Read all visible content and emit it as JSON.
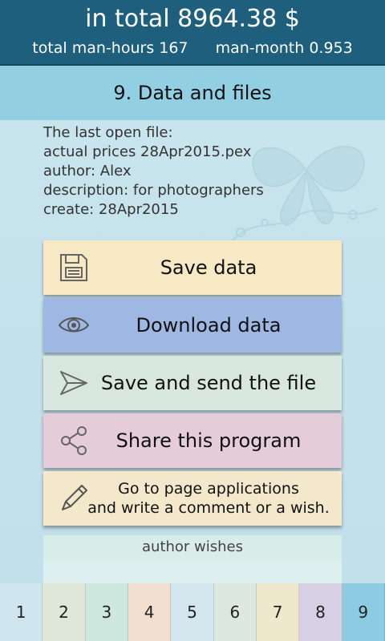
{
  "header": {
    "total": "in total 8964.38 $",
    "man_hours": "total man-hours 167",
    "man_month": "man-month 0.953"
  },
  "section": {
    "title": "9. Data and files"
  },
  "file_info": {
    "line1": "The last open file:",
    "line2": "actual prices 28Apr2015.pex",
    "line3": "author: Alex",
    "line4": "description: for photographers",
    "line5": "create: 28Apr2015"
  },
  "buttons": {
    "save": {
      "label": "Save data",
      "icon": "floppy-icon",
      "color": "#f6e9c4"
    },
    "download": {
      "label": "Download data",
      "icon": "eye-icon",
      "color": "#9fb8e3"
    },
    "send": {
      "label": "Save and send the file",
      "icon": "send-icon",
      "color": "#d7e6df"
    },
    "share": {
      "label": "Share this program",
      "icon": "share-icon",
      "color": "#e4ccd8"
    },
    "comment": {
      "line1": "Go to page applications",
      "line2": "and write a comment or a wish.",
      "icon": "pencil-icon",
      "color": "#f4e8cc"
    }
  },
  "author_wishes": "author wishes",
  "tabs": [
    {
      "label": "1",
      "color": "#cfe6ee"
    },
    {
      "label": "2",
      "color": "#dfe7d9"
    },
    {
      "label": "3",
      "color": "#cfe8df"
    },
    {
      "label": "4",
      "color": "#f1e0cf"
    },
    {
      "label": "5",
      "color": "#d3e6ee"
    },
    {
      "label": "6",
      "color": "#dbe7df"
    },
    {
      "label": "7",
      "color": "#efe8cd"
    },
    {
      "label": "8",
      "color": "#d7cfe3"
    },
    {
      "label": "9",
      "color": "#8ccbe1",
      "active": true
    }
  ]
}
